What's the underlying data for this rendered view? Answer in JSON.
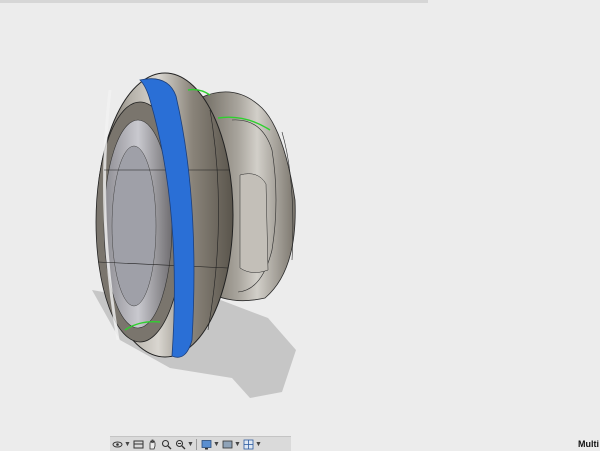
{
  "canvas": {
    "background": "#ececec",
    "model": {
      "body_color": "#8a8479",
      "highlight_color": "#d8d6d2",
      "selected_face_color": "#2a6fd6",
      "edge_color": "#1e1e1e",
      "selected_edge_color": "#2fd02f"
    }
  },
  "navbar": {
    "icons": [
      "orbit-icon",
      "look-at-icon",
      "pan-hand-icon",
      "zoom-icon",
      "zoom-fit-icon",
      "display-mode-icon",
      "visual-style-icon",
      "grid-icon"
    ]
  },
  "status": {
    "label": "Multi"
  }
}
